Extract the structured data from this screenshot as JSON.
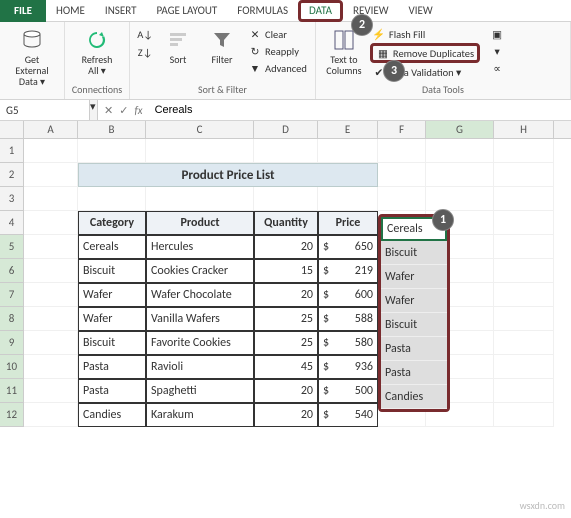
{
  "tabs": {
    "file": "FILE",
    "home": "HOME",
    "insert": "INSERT",
    "page_layout": "PAGE LAYOUT",
    "formulas": "FORMULAS",
    "data": "DATA",
    "review": "REVIEW",
    "view": "VIEW"
  },
  "ribbon": {
    "get_external": "Get External\nData ▾",
    "refresh": "Refresh\nAll ▾",
    "connections_grp": "Connections",
    "sort_az": "A→Z",
    "sort_za": "Z→A",
    "sort": "Sort",
    "filter": "Filter",
    "clear": "Clear",
    "reapply": "Reapply",
    "advanced": "Advanced",
    "sort_filter_grp": "Sort & Filter",
    "text_cols": "Text to\nColumns",
    "flash_fill": "Flash Fill",
    "remove_dup": "Remove Duplicates",
    "data_val": "Data Validation ▾",
    "data_tools_grp": "Data Tools"
  },
  "callouts": {
    "c1": "1",
    "c2": "2",
    "c3": "3"
  },
  "name_box": "G5",
  "formula": "Cereals",
  "cols": [
    "A",
    "B",
    "C",
    "D",
    "E",
    "F",
    "G",
    "H"
  ],
  "rows": [
    "1",
    "2",
    "3",
    "4",
    "5",
    "6",
    "7",
    "8",
    "9",
    "10",
    "11",
    "12"
  ],
  "title": "Product Price List",
  "headers": {
    "cat": "Category",
    "prod": "Product",
    "qty": "Quantity",
    "price": "Price"
  },
  "data": [
    {
      "cat": "Cereals",
      "prod": "Hercules",
      "qty": "20",
      "price": "650"
    },
    {
      "cat": "Biscuit",
      "prod": "Cookies Cracker",
      "qty": "15",
      "price": "219"
    },
    {
      "cat": "Wafer",
      "prod": "Wafer Chocolate",
      "qty": "20",
      "price": "600"
    },
    {
      "cat": "Wafer",
      "prod": "Vanilla Wafers",
      "qty": "25",
      "price": "588"
    },
    {
      "cat": "Biscuit",
      "prod": "Favorite Cookies",
      "qty": "25",
      "price": "580"
    },
    {
      "cat": "Pasta",
      "prod": "Ravioli",
      "qty": "45",
      "price": "936"
    },
    {
      "cat": "Pasta",
      "prod": "Spaghetti",
      "qty": "20",
      "price": "500"
    },
    {
      "cat": "Candies",
      "prod": "Karakum",
      "qty": "20",
      "price": "540"
    }
  ],
  "dollar": "$",
  "gcol": [
    "Cereals",
    "Biscuit",
    "Wafer",
    "Wafer",
    "Biscuit",
    "Pasta",
    "Pasta",
    "Candies"
  ],
  "watermark": "wsxdn.com"
}
